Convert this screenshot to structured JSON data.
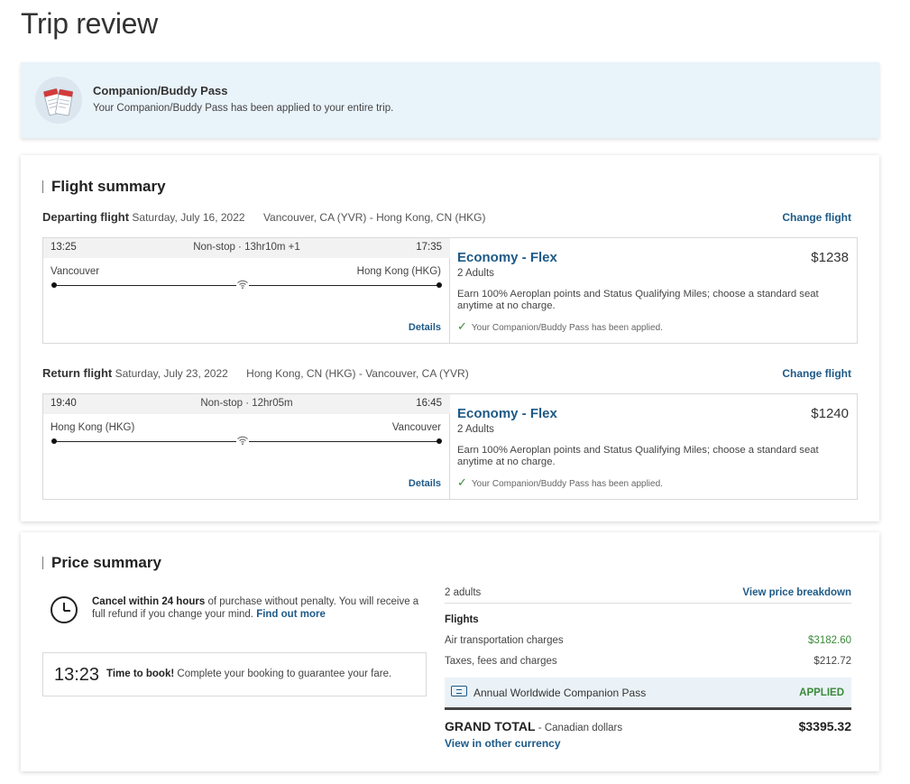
{
  "page": {
    "title": "Trip review"
  },
  "banner": {
    "title": "Companion/Buddy Pass",
    "text": "Your Companion/Buddy Pass has been applied to your entire trip.",
    "icon": "tickets-icon"
  },
  "flight_summary": {
    "title": "Flight summary",
    "change_label": "Change flight",
    "details_label": "Details",
    "legs": [
      {
        "label": "Departing flight",
        "date": "Saturday, July 16, 2022",
        "route": "Vancouver, CA (YVR) - Hong Kong, CN (HKG)",
        "dep_time": "13:25",
        "stops": "Non-stop · 13hr10m +1",
        "arr_time": "17:35",
        "from": "Vancouver",
        "to": "Hong Kong (HKG)",
        "fare": "Economy - Flex",
        "price": "$1238",
        "pax": "2 Adults",
        "desc": "Earn 100% Aeroplan points and Status Qualifying Miles; choose a standard seat anytime at no charge.",
        "applied": "Your Companion/Buddy Pass has been applied."
      },
      {
        "label": "Return flight",
        "date": "Saturday, July 23, 2022",
        "route": "Hong Kong, CN (HKG) - Vancouver, CA (YVR)",
        "dep_time": "19:40",
        "stops": "Non-stop · 12hr05m",
        "arr_time": "16:45",
        "from": "Hong Kong (HKG)",
        "to": "Vancouver",
        "fare": "Economy - Flex",
        "price": "$1240",
        "pax": "2 Adults",
        "desc": "Earn 100% Aeroplan points and Status Qualifying Miles; choose a standard seat anytime at no charge.",
        "applied": "Your Companion/Buddy Pass has been applied."
      }
    ]
  },
  "price_summary": {
    "title": "Price summary",
    "cancel_bold": "Cancel within 24 hours",
    "cancel_text": " of purchase without penalty. You will receive a full refund if you change your mind. ",
    "cancel_link": "Find out more",
    "timer": "13:23",
    "timer_bold": "Time to book!",
    "timer_text": " Complete your booking to guarantee your fare.",
    "adults": "2 adults",
    "breakdown_link": "View price breakdown",
    "flights_heading": "Flights",
    "air_label": "Air transportation charges",
    "air_value": "$3182.60",
    "tax_label": "Taxes, fees and charges",
    "tax_value": "$212.72",
    "pass_label": "Annual Worldwide Companion Pass",
    "pass_status": "APPLIED",
    "grand_label": "GRAND TOTAL",
    "grand_sub": " - Canadian dollars",
    "grand_value": "$3395.32",
    "currency_link": "View in other currency"
  }
}
